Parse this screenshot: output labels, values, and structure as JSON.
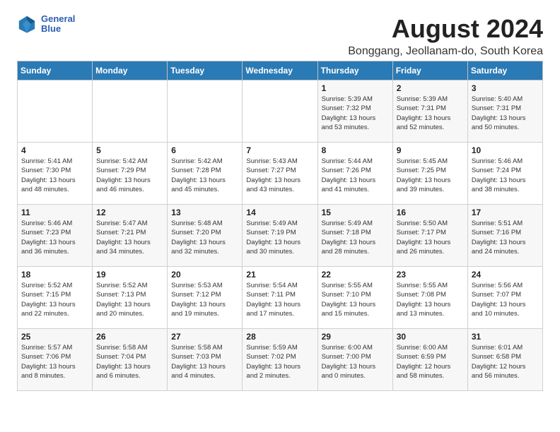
{
  "header": {
    "logo_general": "General",
    "logo_blue": "Blue",
    "title": "August 2024",
    "subtitle": "Bonggang, Jeollanam-do, South Korea"
  },
  "days_of_week": [
    "Sunday",
    "Monday",
    "Tuesday",
    "Wednesday",
    "Thursday",
    "Friday",
    "Saturday"
  ],
  "weeks": [
    [
      {
        "day": "",
        "info": ""
      },
      {
        "day": "",
        "info": ""
      },
      {
        "day": "",
        "info": ""
      },
      {
        "day": "",
        "info": ""
      },
      {
        "day": "1",
        "info": "Sunrise: 5:39 AM\nSunset: 7:32 PM\nDaylight: 13 hours\nand 53 minutes."
      },
      {
        "day": "2",
        "info": "Sunrise: 5:39 AM\nSunset: 7:31 PM\nDaylight: 13 hours\nand 52 minutes."
      },
      {
        "day": "3",
        "info": "Sunrise: 5:40 AM\nSunset: 7:31 PM\nDaylight: 13 hours\nand 50 minutes."
      }
    ],
    [
      {
        "day": "4",
        "info": "Sunrise: 5:41 AM\nSunset: 7:30 PM\nDaylight: 13 hours\nand 48 minutes."
      },
      {
        "day": "5",
        "info": "Sunrise: 5:42 AM\nSunset: 7:29 PM\nDaylight: 13 hours\nand 46 minutes."
      },
      {
        "day": "6",
        "info": "Sunrise: 5:42 AM\nSunset: 7:28 PM\nDaylight: 13 hours\nand 45 minutes."
      },
      {
        "day": "7",
        "info": "Sunrise: 5:43 AM\nSunset: 7:27 PM\nDaylight: 13 hours\nand 43 minutes."
      },
      {
        "day": "8",
        "info": "Sunrise: 5:44 AM\nSunset: 7:26 PM\nDaylight: 13 hours\nand 41 minutes."
      },
      {
        "day": "9",
        "info": "Sunrise: 5:45 AM\nSunset: 7:25 PM\nDaylight: 13 hours\nand 39 minutes."
      },
      {
        "day": "10",
        "info": "Sunrise: 5:46 AM\nSunset: 7:24 PM\nDaylight: 13 hours\nand 38 minutes."
      }
    ],
    [
      {
        "day": "11",
        "info": "Sunrise: 5:46 AM\nSunset: 7:23 PM\nDaylight: 13 hours\nand 36 minutes."
      },
      {
        "day": "12",
        "info": "Sunrise: 5:47 AM\nSunset: 7:21 PM\nDaylight: 13 hours\nand 34 minutes."
      },
      {
        "day": "13",
        "info": "Sunrise: 5:48 AM\nSunset: 7:20 PM\nDaylight: 13 hours\nand 32 minutes."
      },
      {
        "day": "14",
        "info": "Sunrise: 5:49 AM\nSunset: 7:19 PM\nDaylight: 13 hours\nand 30 minutes."
      },
      {
        "day": "15",
        "info": "Sunrise: 5:49 AM\nSunset: 7:18 PM\nDaylight: 13 hours\nand 28 minutes."
      },
      {
        "day": "16",
        "info": "Sunrise: 5:50 AM\nSunset: 7:17 PM\nDaylight: 13 hours\nand 26 minutes."
      },
      {
        "day": "17",
        "info": "Sunrise: 5:51 AM\nSunset: 7:16 PM\nDaylight: 13 hours\nand 24 minutes."
      }
    ],
    [
      {
        "day": "18",
        "info": "Sunrise: 5:52 AM\nSunset: 7:15 PM\nDaylight: 13 hours\nand 22 minutes."
      },
      {
        "day": "19",
        "info": "Sunrise: 5:52 AM\nSunset: 7:13 PM\nDaylight: 13 hours\nand 20 minutes."
      },
      {
        "day": "20",
        "info": "Sunrise: 5:53 AM\nSunset: 7:12 PM\nDaylight: 13 hours\nand 19 minutes."
      },
      {
        "day": "21",
        "info": "Sunrise: 5:54 AM\nSunset: 7:11 PM\nDaylight: 13 hours\nand 17 minutes."
      },
      {
        "day": "22",
        "info": "Sunrise: 5:55 AM\nSunset: 7:10 PM\nDaylight: 13 hours\nand 15 minutes."
      },
      {
        "day": "23",
        "info": "Sunrise: 5:55 AM\nSunset: 7:08 PM\nDaylight: 13 hours\nand 13 minutes."
      },
      {
        "day": "24",
        "info": "Sunrise: 5:56 AM\nSunset: 7:07 PM\nDaylight: 13 hours\nand 10 minutes."
      }
    ],
    [
      {
        "day": "25",
        "info": "Sunrise: 5:57 AM\nSunset: 7:06 PM\nDaylight: 13 hours\nand 8 minutes."
      },
      {
        "day": "26",
        "info": "Sunrise: 5:58 AM\nSunset: 7:04 PM\nDaylight: 13 hours\nand 6 minutes."
      },
      {
        "day": "27",
        "info": "Sunrise: 5:58 AM\nSunset: 7:03 PM\nDaylight: 13 hours\nand 4 minutes."
      },
      {
        "day": "28",
        "info": "Sunrise: 5:59 AM\nSunset: 7:02 PM\nDaylight: 13 hours\nand 2 minutes."
      },
      {
        "day": "29",
        "info": "Sunrise: 6:00 AM\nSunset: 7:00 PM\nDaylight: 13 hours\nand 0 minutes."
      },
      {
        "day": "30",
        "info": "Sunrise: 6:00 AM\nSunset: 6:59 PM\nDaylight: 12 hours\nand 58 minutes."
      },
      {
        "day": "31",
        "info": "Sunrise: 6:01 AM\nSunset: 6:58 PM\nDaylight: 12 hours\nand 56 minutes."
      }
    ]
  ]
}
